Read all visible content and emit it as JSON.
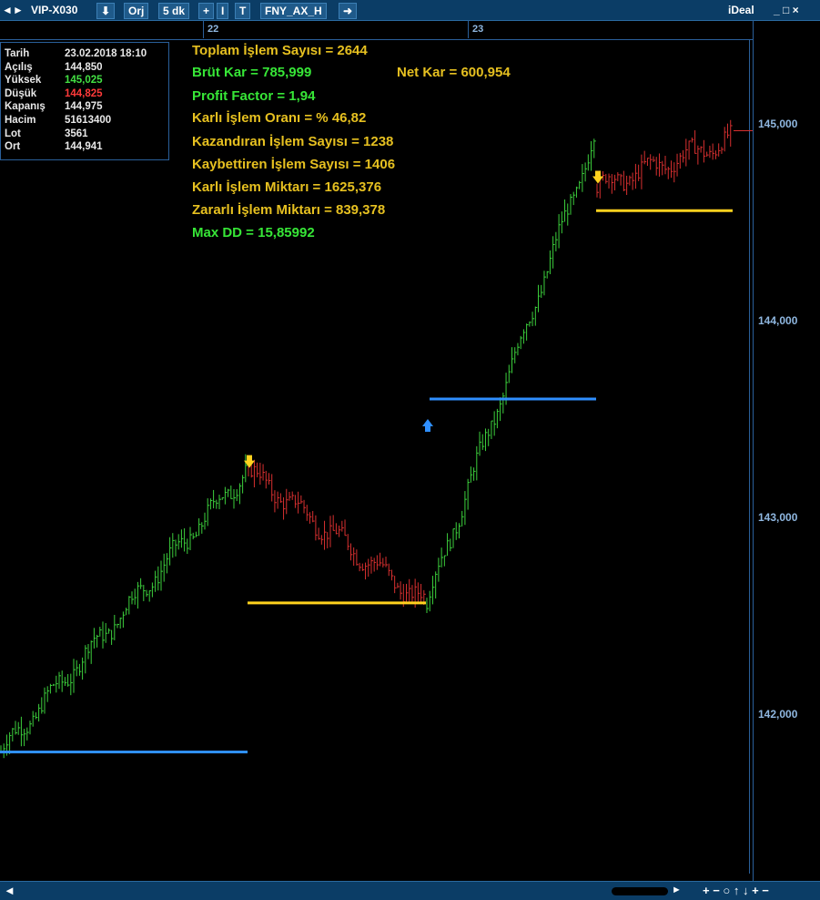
{
  "titlebar": {
    "symbol": "VIP-X030",
    "orj_label": "Orj",
    "period_label": "5 dk",
    "formula_label": "FNY_AX_H",
    "brand": "iDeal",
    "win_controls": "_ □ ×"
  },
  "dates": {
    "d1": "22",
    "d2": "23"
  },
  "info": {
    "rows": [
      {
        "label": "Tarih",
        "value": "23.02.2018 18:10",
        "color": "#e8e8e8"
      },
      {
        "label": "Açılış",
        "value": "144,850",
        "color": "#e8e8e8"
      },
      {
        "label": "Yüksek",
        "value": "145,025",
        "color": "#43e043"
      },
      {
        "label": "Düşük",
        "value": "144,825",
        "color": "#ff3a3a"
      },
      {
        "label": "Kapanış",
        "value": "144,975",
        "color": "#e8e8e8"
      },
      {
        "label": "Hacim",
        "value": "51613400",
        "color": "#e8e8e8"
      },
      {
        "label": "Lot",
        "value": "3561",
        "color": "#e8e8e8"
      },
      {
        "label": "Ort",
        "value": "144,941",
        "color": "#e8e8e8"
      }
    ]
  },
  "stats": {
    "total_trades": "Toplam İşlem Sayısı =  2644",
    "gross_profit": "Brüt Kar =  785,999",
    "net_profit": "Net Kar =  600,954",
    "profit_factor": "Profit Factor =  1,94",
    "win_rate": "Karlı İşlem Oranı = % 46,82",
    "winning_trades": "Kazandıran İşlem Sayısı =  1238",
    "losing_trades": "Kaybettiren İşlem Sayısı =  1406",
    "win_amount": "Karlı İşlem Miktarı =  1625,376",
    "loss_amount": "Zararlı İşlem Miktarı =  839,378",
    "max_dd": "Max DD = 15,85992",
    "colors": {
      "gold": "#e6c020",
      "green": "#37e637"
    }
  },
  "y_axis": {
    "labels": [
      "145,000",
      "144,000",
      "143,000",
      "142,000"
    ],
    "values": [
      145000,
      144000,
      143000,
      142000
    ]
  },
  "chart_data": {
    "type": "bar",
    "y_range": [
      141200,
      145450
    ],
    "segments": [
      {
        "dir": "up",
        "start": 141820,
        "end": 143250,
        "level": 141820
      },
      {
        "dir": "down",
        "start": 143250,
        "end": 142580,
        "level": 142580
      },
      {
        "dir": "up",
        "start": 142580,
        "end": 144950,
        "level": 143620
      },
      {
        "dir": "down",
        "start": 144700,
        "end": 144940,
        "level": 144580
      }
    ],
    "colors": {
      "up": "#3ccf3c",
      "down": "#d83030",
      "long_level": "#2f8fff",
      "short_level": "#ffd21e"
    }
  },
  "bottombar": {
    "controls": "+ − ○ ↑ ↓ + −"
  }
}
